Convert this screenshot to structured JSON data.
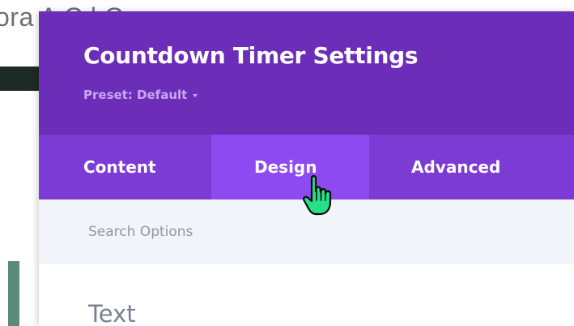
{
  "background": {
    "title_fragment": "ora         A           C    l          C     "
  },
  "modal": {
    "title": "Countdown Timer Settings",
    "preset_label": "Preset: Default",
    "preset_icon": "caret-down-icon",
    "tabs": [
      {
        "label": "Content",
        "active": false
      },
      {
        "label": "Design",
        "active": true
      },
      {
        "label": "Advanced",
        "active": false
      }
    ],
    "search": {
      "placeholder": "Search Options",
      "value": ""
    },
    "section_heading": "Text"
  },
  "colors": {
    "header_bg": "#6c2eb9",
    "tabs_bg": "#7d3bd5",
    "tab_active_bg": "#8c4af0",
    "search_bg": "#f1f5f9",
    "cursor_fill": "#27e08a"
  },
  "cursor": {
    "type": "hand-pointer-icon"
  }
}
